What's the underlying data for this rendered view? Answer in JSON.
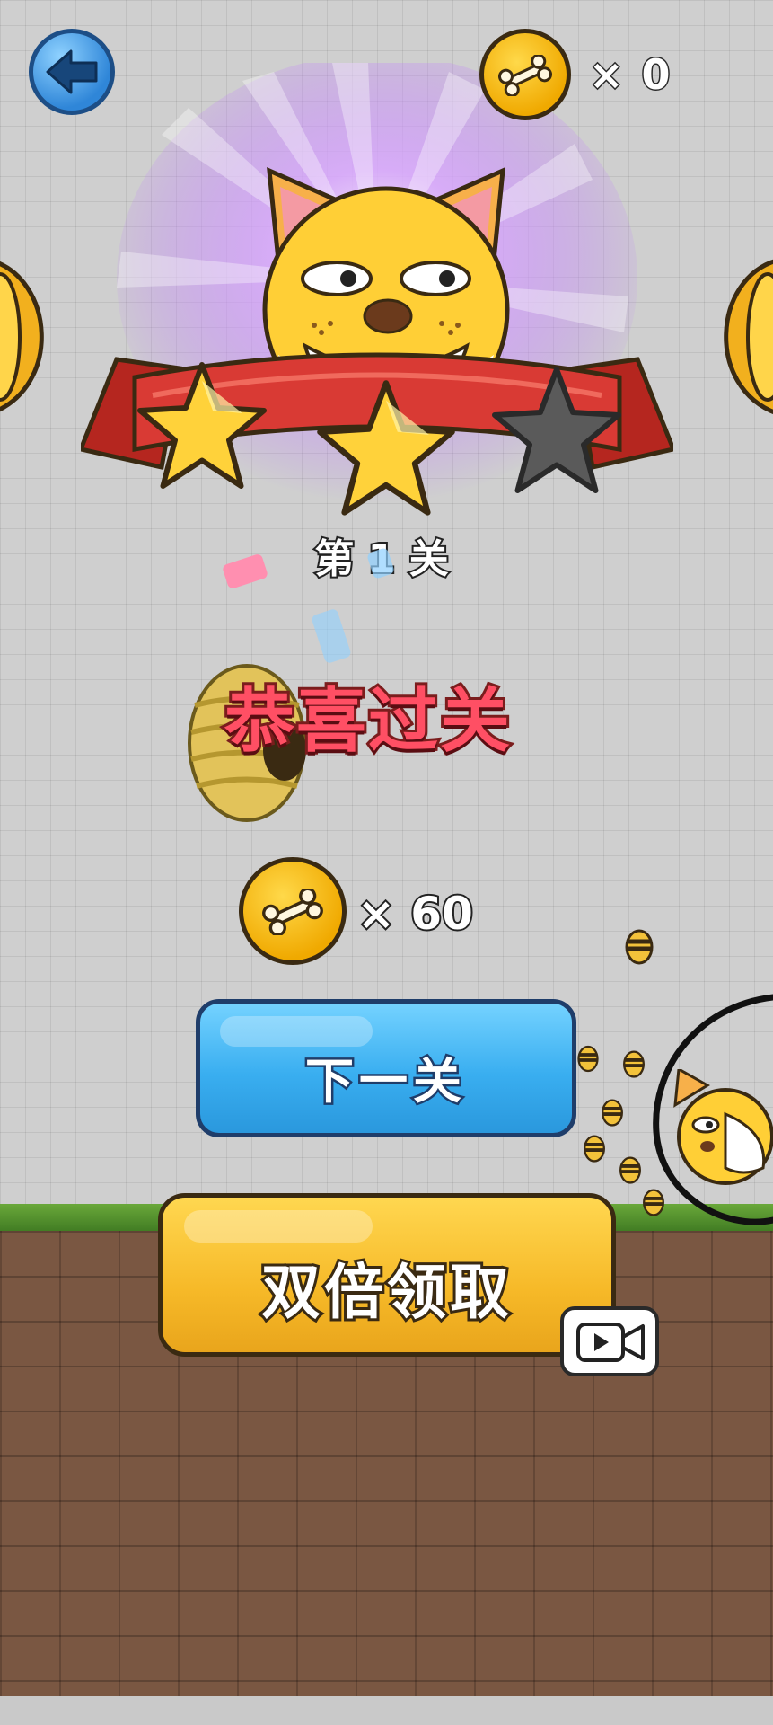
{
  "hud": {
    "back_icon": "arrow-left-icon",
    "coin_icon": "bone-coin-icon",
    "coin_count": "× 0"
  },
  "result": {
    "stars_earned": 2,
    "stars_total": 3,
    "level_label": "第 1 关",
    "congrats_text": "恭喜过关"
  },
  "reward": {
    "coin_icon": "bone-coin-icon",
    "amount_label": "× 60"
  },
  "buttons": {
    "next_level": "下一关",
    "double_claim": "双倍领取",
    "video_icon": "video-camera-icon"
  },
  "colors": {
    "background": "#cfcfcf",
    "next_button": "#39aef0",
    "double_button": "#f6b928",
    "congrats_text": "#ff4f64",
    "ribbon": "#d93a34",
    "star_gold": "#ffd23a",
    "star_empty": "#5a5a5a"
  }
}
